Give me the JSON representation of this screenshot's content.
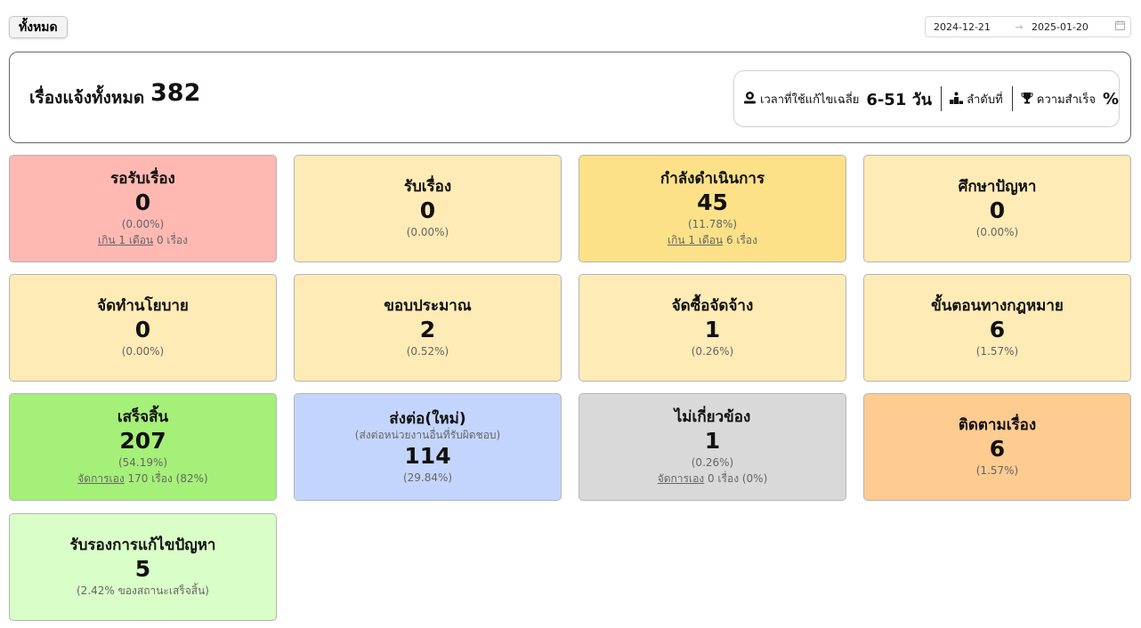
{
  "filter": {
    "label": "ทั้งหมด"
  },
  "date_range": {
    "start": "2024-12-21",
    "arrow": "→",
    "end": "2025-01-20"
  },
  "summary": {
    "label": "เรื่องแจ้งทั้งหมด",
    "total": "382",
    "avg_time_label": "เวลาที่ใช้แก้ไขเฉลี่ย",
    "avg_time_value": "6-51 วัน",
    "rank_label": "ลำดับที่",
    "success_label": "ความสำเร็จ",
    "success_value": "%"
  },
  "cards": [
    {
      "title": "รอรับเรื่อง",
      "count": "0",
      "pct": "(0.00%)",
      "extra_link": "เกิน 1 เดือน",
      "extra_text": " 0 เรื่อง",
      "color": "#ffb9b2"
    },
    {
      "title": "รับเรื่อง",
      "count": "0",
      "pct": "(0.00%)",
      "color": "#feebb6"
    },
    {
      "title": "กำลังดำเนินการ",
      "count": "45",
      "pct": "(11.78%)",
      "extra_link": "เกิน 1 เดือน",
      "extra_text": " 6 เรื่อง",
      "color": "#fde188"
    },
    {
      "title": "ศึกษาปัญหา",
      "count": "0",
      "pct": "(0.00%)",
      "color": "#feebb6"
    },
    {
      "title": "จัดทำนโยบาย",
      "count": "0",
      "pct": "(0.00%)",
      "color": "#feebb6"
    },
    {
      "title": "ขอบประมาณ",
      "count": "2",
      "pct": "(0.52%)",
      "color": "#feebb6"
    },
    {
      "title": "จัดซื้อจัดจ้าง",
      "count": "1",
      "pct": "(0.26%)",
      "color": "#feebb6"
    },
    {
      "title": "ขั้นตอนทางกฎหมาย",
      "count": "6",
      "pct": "(1.57%)",
      "color": "#feebb6"
    },
    {
      "title": "เสร็จสิ้น",
      "count": "207",
      "pct": "(54.19%)",
      "extra_link": "จัดการเอง",
      "extra_text": " 170 เรื่อง (82%)",
      "color": "#a5f078"
    },
    {
      "title": "ส่งต่อ(ใหม่)",
      "subtitle": "(ส่งต่อหน่วยงานอื่นที่รับผิดชอบ)",
      "count": "114",
      "pct": "(29.84%)",
      "color": "#c4d5fd"
    },
    {
      "title": "ไม่เกี่ยวข้อง",
      "count": "1",
      "pct": "(0.26%)",
      "extra_link": "จัดการเอง",
      "extra_text": " 0 เรื่อง (0%)",
      "color": "#d9d9d9"
    },
    {
      "title": "ติดตามเรื่อง",
      "count": "6",
      "pct": "(1.57%)",
      "color": "#fecb91"
    },
    {
      "title": "รับรองการแก้ไขปัญหา",
      "count": "5",
      "pct": "(2.42% ของสถานะเสร็จสิ้น)",
      "color": "#d9fec8"
    }
  ]
}
